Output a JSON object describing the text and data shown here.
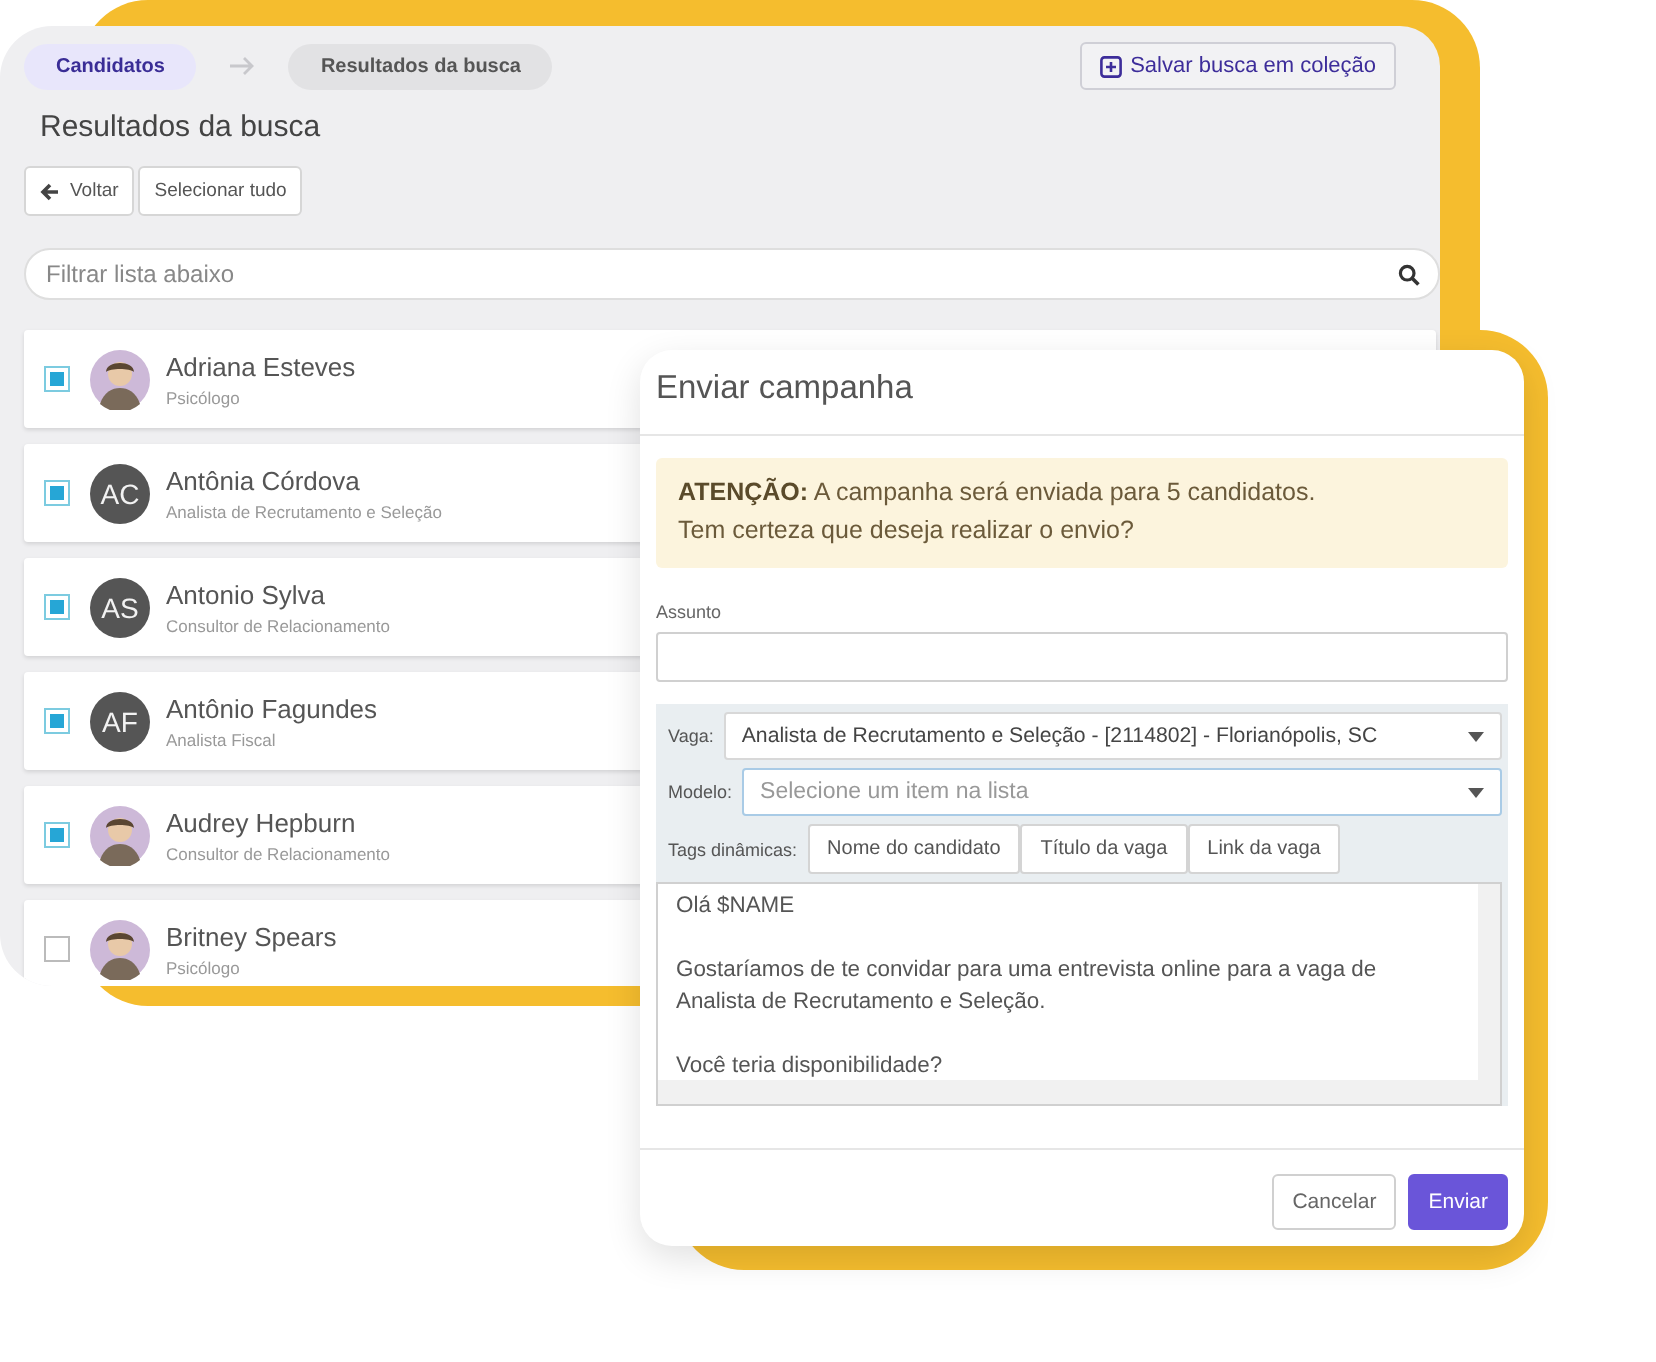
{
  "breadcrumb": [
    {
      "label": "Candidatos",
      "selected": true
    },
    {
      "label": "Resultados da busca",
      "selected": false
    }
  ],
  "save_button": "Salvar busca em coleção",
  "page_title": "Resultados da busca",
  "toolbar": [
    {
      "label": "Voltar",
      "kind": "back"
    },
    {
      "label": "Selecionar tudo",
      "kind": "plain"
    }
  ],
  "filter": {
    "placeholder": "Filtrar lista abaixo"
  },
  "candidates": [
    {
      "name": "Adriana Esteves",
      "role": "Psicólogo",
      "checked": true
    },
    {
      "name": "Antônia Córdova",
      "role": "Analista de Recrutamento e Seleção",
      "checked": true,
      "avatar": {
        "kind": "initials",
        "text": "AC"
      }
    },
    {
      "name": "Antonio Sylva",
      "role": "Consultor de Relacionamento",
      "checked": true,
      "avatar": {
        "kind": "initials",
        "text": "AS"
      }
    },
    {
      "name": "Antônio Fagundes",
      "role": "Analista Fiscal",
      "checked": true,
      "avatar": {
        "kind": "initials",
        "text": "AF"
      }
    },
    {
      "name": "Audrey Hepburn",
      "role": "Consultor de Relacionamento",
      "checked": true
    },
    {
      "name": "Britney Spears",
      "role": "Psicólogo",
      "checked": false
    }
  ],
  "dialog": {
    "title": "Enviar campanha",
    "alert": [
      "**ATENÇÃO:** A campanha será enviada para 5 candidatos.",
      "Tem certeza que deseja realizar o envio?"
    ],
    "subject": {
      "label": "Assunto"
    },
    "vacancy": {
      "label": "Vaga:",
      "value": "Analista de Recrutamento e Seleção - [2114802] - Florianópolis, SC"
    },
    "template": {
      "label": "Modelo:",
      "placeholder": "Selecione um item na lista"
    },
    "tags": {
      "label": "Tags dinâmicas:",
      "buttons": [
        "Nome do candidato",
        "Título da vaga",
        "Link da vaga"
      ]
    },
    "message": [
      "Olá $NAME",
      "Gostaríamos de te convidar para uma entrevista online para a vaga de Analista de Recrutamento e Seleção.",
      "Você teria disponibilidade?"
    ],
    "buttons": [
      {
        "label": "Cancelar",
        "kind": "secondary"
      },
      {
        "label": "Enviar",
        "kind": "primary"
      }
    ]
  }
}
